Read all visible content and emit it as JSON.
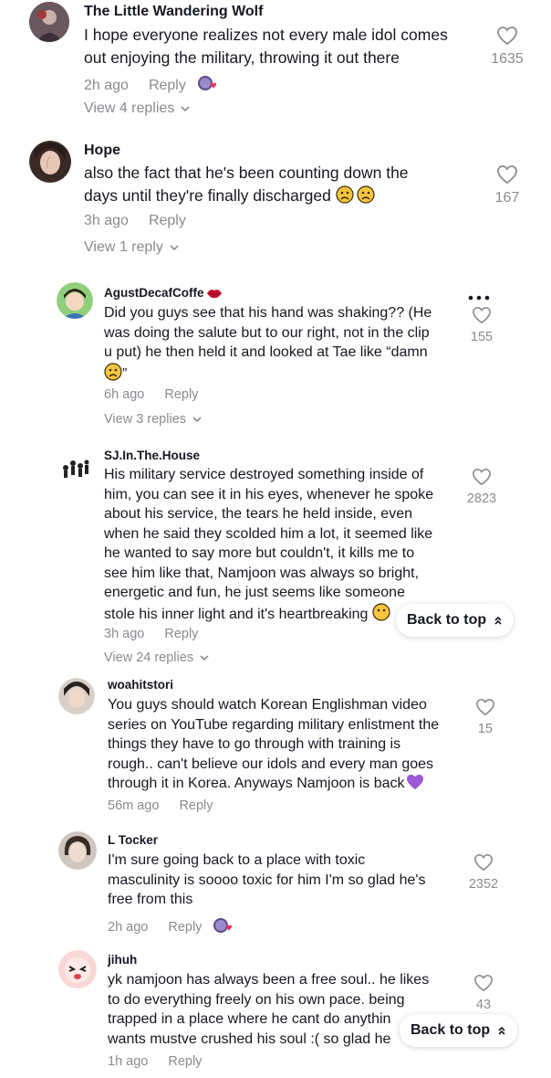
{
  "comments": [
    {
      "author": "The Little Wandering Wolf",
      "lines": [
        "I hope everyone realizes not every male idol comes",
        "out enjoying the military, throwing it out there"
      ],
      "time": "2h ago",
      "reply": "Reply",
      "likes": "1635",
      "view_replies": "View 4 replies",
      "creator_liked": true
    },
    {
      "author": "Hope",
      "lines": [
        "also the fact that he's been counting down the",
        "days until they're finally discharged"
      ],
      "time": "3h ago",
      "reply": "Reply",
      "likes": "167",
      "view_replies": "View 1 reply"
    },
    {
      "author": "AgustDecafCoffe",
      "lines": [
        "Did you guys see that his hand was shaking?? (He",
        "was doing the salute but to our right, not in the clip",
        "u put) he then held it and looked at Tae like “damn",
        "”"
      ],
      "time": "6h ago",
      "reply": "Reply",
      "likes": "155",
      "view_replies": "View 3 replies"
    },
    {
      "author": "SJ.In.The.House",
      "lines": [
        "His military service destroyed something inside of",
        "him, you can see it in his eyes, whenever he spoke",
        "about his service, the tears he held inside, even",
        "when he said they scolded him a lot, it seemed like",
        "he wanted to say more but couldn't, it kills me to",
        "see him like that, Namjoon was always so bright,",
        "energetic and fun, he just seems like someone",
        "stole his inner light and it's heartbreaking"
      ],
      "time": "3h ago",
      "reply": "Reply",
      "likes": "2823",
      "view_replies": "View 24 replies"
    },
    {
      "author": "woahitstori",
      "lines": [
        "You guys should watch Korean Englishman video",
        "series on YouTube regarding military enlistment the",
        "things they have to go through with training is",
        "rough.. can't believe our idols and every man goes",
        "through it in Korea. Anyways Namjoon is back"
      ],
      "time": "56m ago",
      "reply": "Reply",
      "likes": "15"
    },
    {
      "author": "L Tocker",
      "lines": [
        "I'm sure going back to a place with toxic",
        "masculinity is soooo toxic for him I'm so glad he's",
        "free from this"
      ],
      "time": "2h ago",
      "reply": "Reply",
      "likes": "2352",
      "creator_liked": true
    },
    {
      "author": "jihuh",
      "lines": [
        "yk namjoon has always been a free soul.. he likes",
        "to do everything freely on his own pace. being",
        "trapped in a place where he cant do anythin",
        "wants mustve crushed his soul :( so glad he"
      ],
      "time": "1h ago",
      "reply": "Reply",
      "likes": "43"
    }
  ],
  "back_to_top": "Back to top",
  "colors": {
    "text": "#161823",
    "muted": "#8a8b91",
    "heart_purple": "#9b59d6"
  }
}
